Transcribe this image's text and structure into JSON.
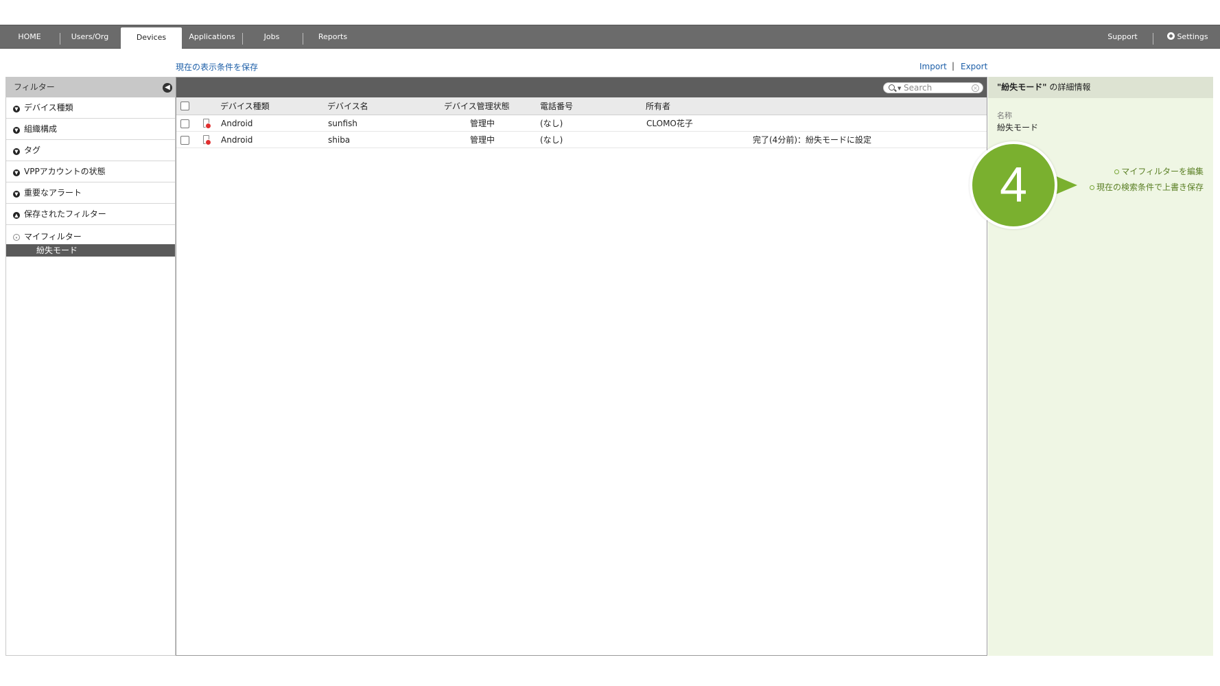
{
  "nav": {
    "tabs": [
      {
        "label": "HOME"
      },
      {
        "label": "Users/Org"
      },
      {
        "label": "Devices"
      },
      {
        "label": "Applications"
      },
      {
        "label": "Jobs"
      },
      {
        "label": "Reports"
      }
    ],
    "support": "Support",
    "settings": "Settings"
  },
  "toolbar_links": {
    "save_view": "現在の表示条件を保存",
    "import": "Import",
    "separator": "|",
    "export": "Export"
  },
  "filter_panel": {
    "title": "フィルター",
    "items": [
      {
        "label": "デバイス種類"
      },
      {
        "label": "組織構成"
      },
      {
        "label": "タグ"
      },
      {
        "label": "VPPアカウントの状態"
      },
      {
        "label": "重要なアラート"
      },
      {
        "label": "保存されたフィルター"
      }
    ],
    "my_filter": "マイフィルター",
    "my_filter_items": [
      {
        "label": "紛失モード"
      }
    ]
  },
  "search": {
    "placeholder": "Search"
  },
  "table": {
    "columns": [
      "デバイス種類",
      "デバイス名",
      "デバイス管理状態",
      "電話番号",
      "所有者"
    ],
    "rows": [
      {
        "type": "Android",
        "name": "sunfish",
        "state": "管理中",
        "phone": "(なし)",
        "owner": "CLOMO花子",
        "job": ""
      },
      {
        "type": "Android",
        "name": "shiba",
        "state": "管理中",
        "phone": "(なし)",
        "owner": "",
        "job": "完了(4分前)：紛失モードに設定"
      }
    ]
  },
  "detail": {
    "title_name": "\"紛失モード\"",
    "title_suffix": " の詳細情報",
    "name_label": "名称",
    "name_value": "紛失モード",
    "actions": [
      {
        "label": "マイフィルターを編集"
      },
      {
        "label": "現在の検索条件で上書き保存"
      }
    ]
  },
  "callout": {
    "number": "4"
  },
  "colors": {
    "nav_bg": "#6b6b6b",
    "link": "#1d5fa8",
    "detail_bg": "#eff6e4",
    "action_green": "#5a7f24",
    "callout_green": "#7ab02f"
  }
}
